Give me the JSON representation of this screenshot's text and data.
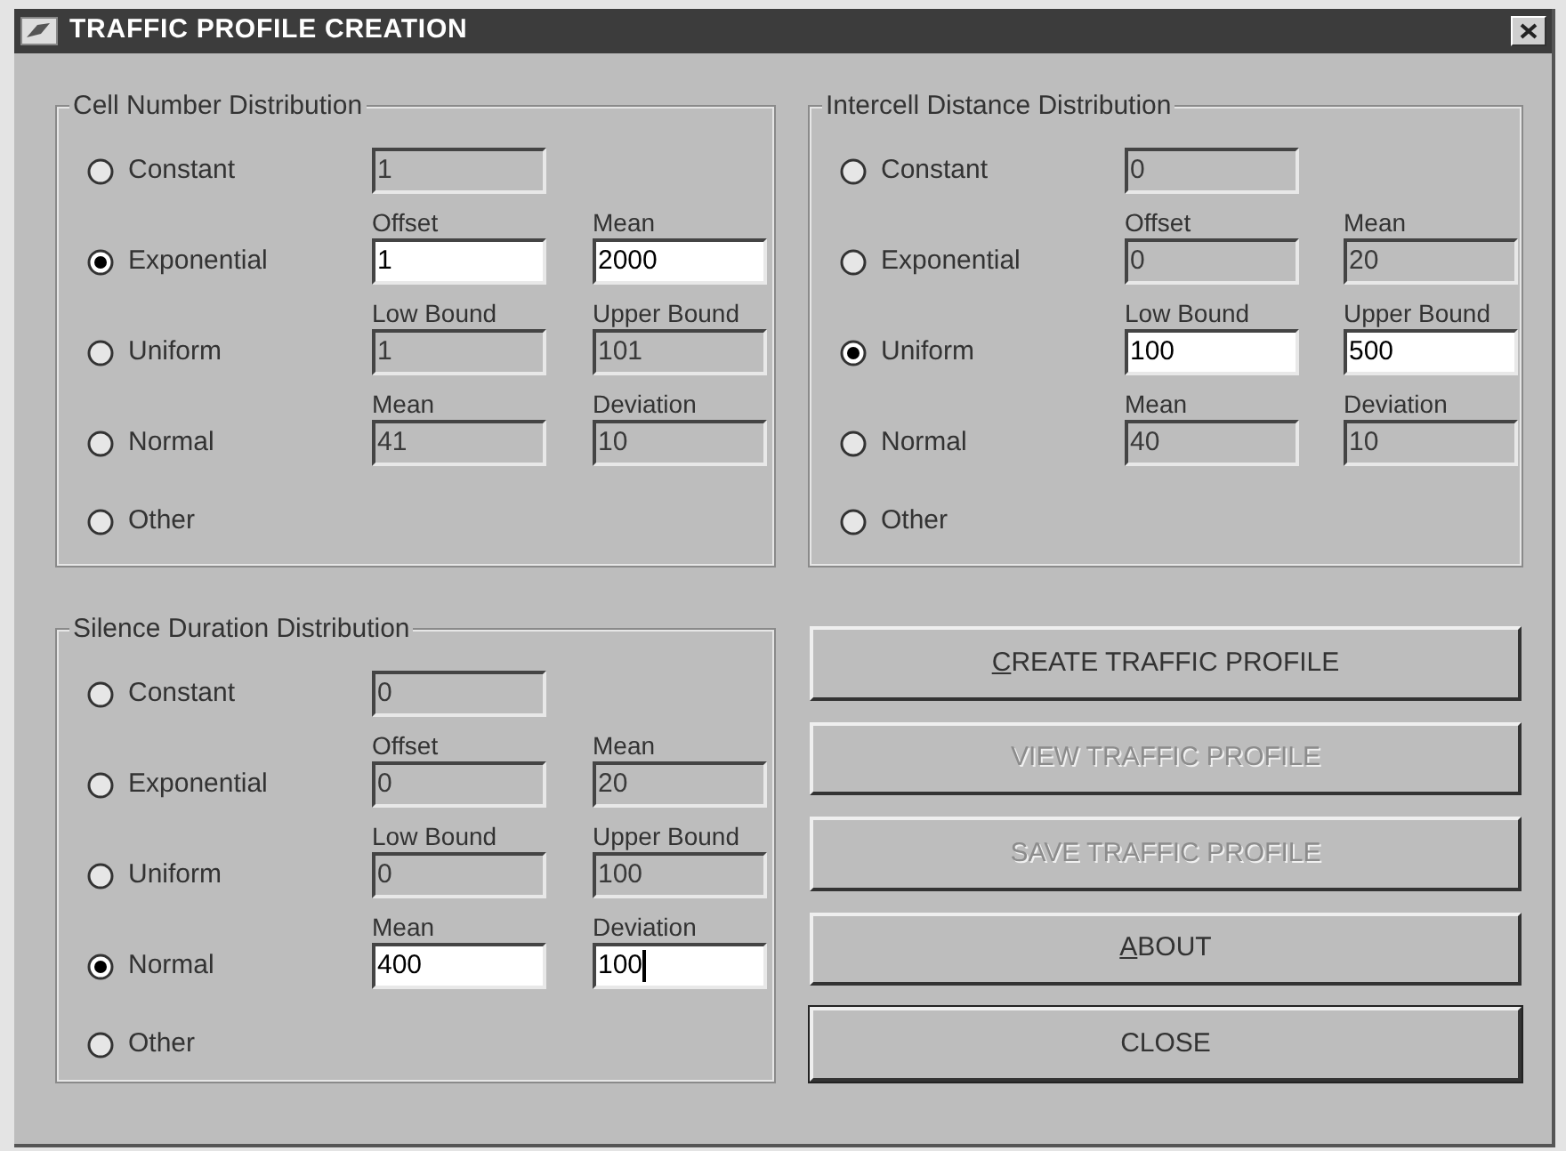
{
  "window": {
    "title": "TRAFFIC PROFILE CREATION"
  },
  "groups": [
    {
      "title": "Cell Number Distribution",
      "options": [
        {
          "label": "Constant",
          "selected": false,
          "fields": [
            {
              "value": "1",
              "enabled": false,
              "focused": false
            }
          ]
        },
        {
          "label": "Exponential",
          "selected": true,
          "fields": [
            {
              "caption": "Offset",
              "value": "1",
              "enabled": true,
              "focused": false
            },
            {
              "caption": "Mean",
              "value": "2000",
              "enabled": true,
              "focused": false
            }
          ]
        },
        {
          "label": "Uniform",
          "selected": false,
          "fields": [
            {
              "caption": "Low Bound",
              "value": "1",
              "enabled": false,
              "focused": false
            },
            {
              "caption": "Upper Bound",
              "value": "101",
              "enabled": false,
              "focused": false
            }
          ]
        },
        {
          "label": "Normal",
          "selected": false,
          "fields": [
            {
              "caption": "Mean",
              "value": "41",
              "enabled": false,
              "focused": false
            },
            {
              "caption": "Deviation",
              "value": "10",
              "enabled": false,
              "focused": false
            }
          ]
        },
        {
          "label": "Other",
          "selected": false
        }
      ]
    },
    {
      "title": "Intercell Distance Distribution",
      "options": [
        {
          "label": "Constant",
          "selected": false,
          "fields": [
            {
              "value": "0",
              "enabled": false,
              "focused": false
            }
          ]
        },
        {
          "label": "Exponential",
          "selected": false,
          "fields": [
            {
              "caption": "Offset",
              "value": "0",
              "enabled": false,
              "focused": false
            },
            {
              "caption": "Mean",
              "value": "20",
              "enabled": false,
              "focused": false
            }
          ]
        },
        {
          "label": "Uniform",
          "selected": true,
          "fields": [
            {
              "caption": "Low Bound",
              "value": "100",
              "enabled": true,
              "focused": false
            },
            {
              "caption": "Upper Bound",
              "value": "500",
              "enabled": true,
              "focused": false
            }
          ]
        },
        {
          "label": "Normal",
          "selected": false,
          "fields": [
            {
              "caption": "Mean",
              "value": "40",
              "enabled": false,
              "focused": false
            },
            {
              "caption": "Deviation",
              "value": "10",
              "enabled": false,
              "focused": false
            }
          ]
        },
        {
          "label": "Other",
          "selected": false
        }
      ]
    },
    {
      "title": "Silence Duration Distribution",
      "options": [
        {
          "label": "Constant",
          "selected": false,
          "fields": [
            {
              "value": "0",
              "enabled": false,
              "focused": false
            }
          ]
        },
        {
          "label": "Exponential",
          "selected": false,
          "fields": [
            {
              "caption": "Offset",
              "value": "0",
              "enabled": false,
              "focused": false
            },
            {
              "caption": "Mean",
              "value": "20",
              "enabled": false,
              "focused": false
            }
          ]
        },
        {
          "label": "Uniform",
          "selected": false,
          "fields": [
            {
              "caption": "Low Bound",
              "value": "0",
              "enabled": false,
              "focused": false
            },
            {
              "caption": "Upper Bound",
              "value": "100",
              "enabled": false,
              "focused": false
            }
          ]
        },
        {
          "label": "Normal",
          "selected": true,
          "fields": [
            {
              "caption": "Mean",
              "value": "400",
              "enabled": true,
              "focused": false
            },
            {
              "caption": "Deviation",
              "value": "100",
              "enabled": true,
              "focused": true
            }
          ]
        },
        {
          "label": "Other",
          "selected": false
        }
      ]
    }
  ],
  "buttons": [
    {
      "label": "CREATE TRAFFIC PROFILE",
      "disabled": false,
      "mnemonic": true,
      "default": false
    },
    {
      "label": "VIEW TRAFFIC PROFILE",
      "disabled": true,
      "mnemonic": false,
      "default": false
    },
    {
      "label": "SAVE TRAFFIC PROFILE",
      "disabled": true,
      "mnemonic": false,
      "default": false
    },
    {
      "label": "ABOUT",
      "disabled": false,
      "mnemonic": true,
      "default": false
    },
    {
      "label": "CLOSE",
      "disabled": false,
      "mnemonic": false,
      "default": true
    }
  ]
}
